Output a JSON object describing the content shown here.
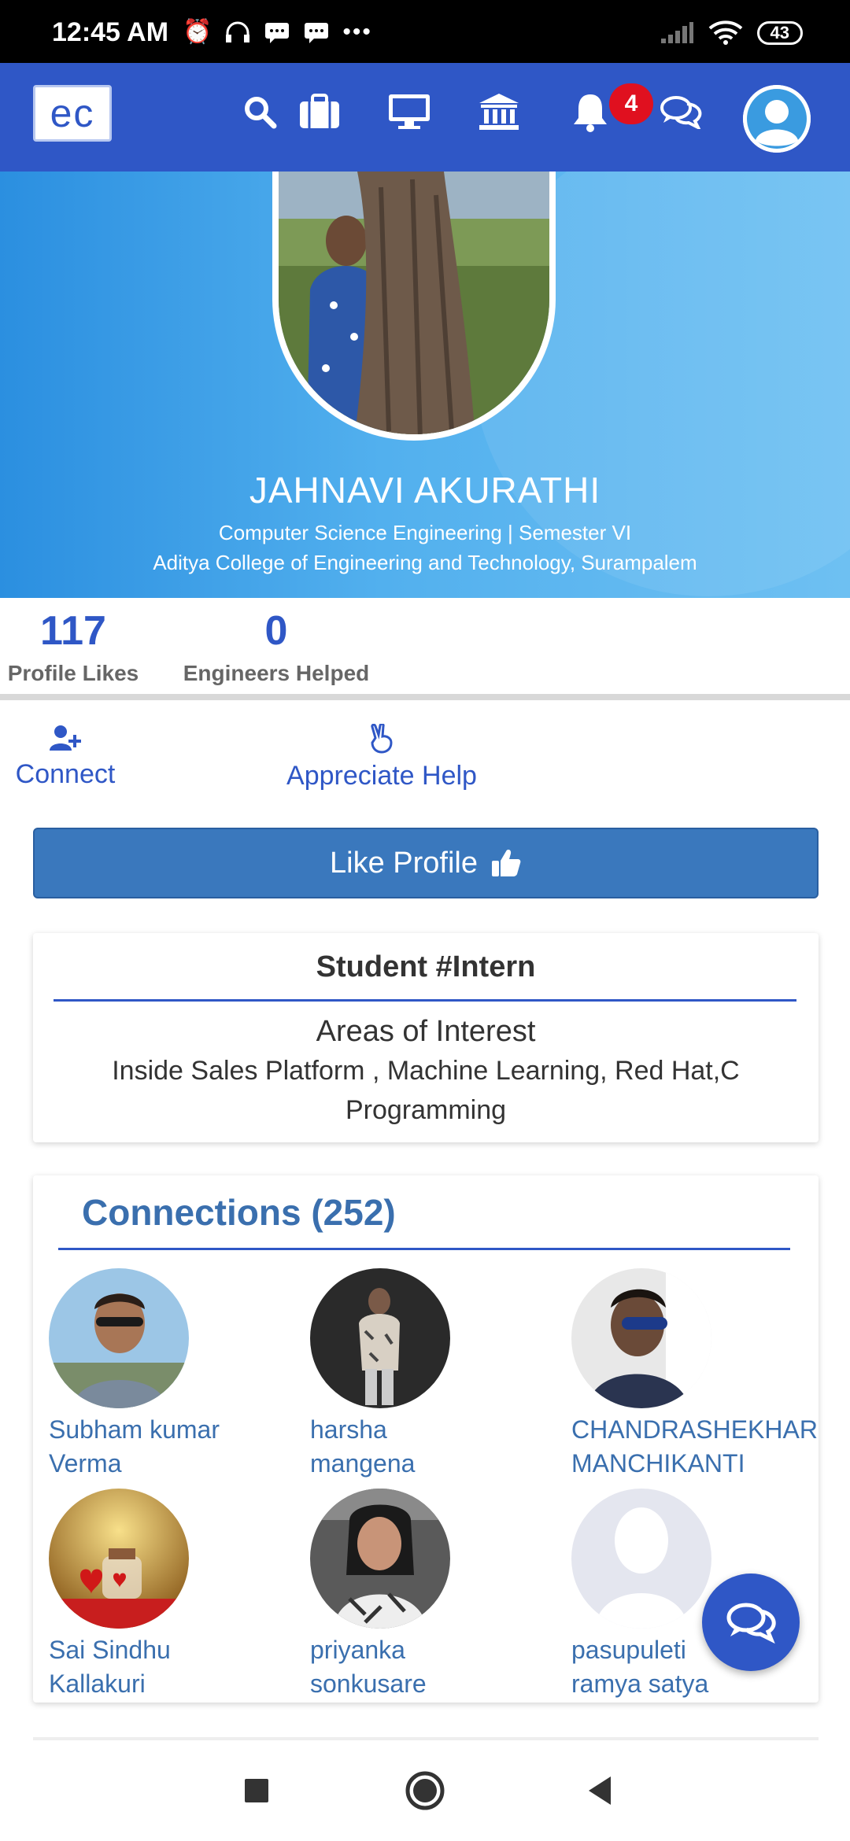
{
  "status_bar": {
    "time": "12:45 AM",
    "icons_left": [
      "alarm-icon",
      "headset-icon",
      "message-icon",
      "message-icon",
      "more-dots-icon"
    ],
    "battery": "43"
  },
  "header": {
    "logo_text": "ec",
    "notification_count": "4",
    "icons": [
      "search-icon",
      "briefcase-icon",
      "monitor-icon",
      "institution-icon",
      "bell-icon",
      "chat-icon",
      "profile-avatar"
    ]
  },
  "profile": {
    "name": "JAHNAVI AKURATHI",
    "department": "Computer Science Engineering | Semester VI",
    "college": "Aditya College of Engineering and Technology, Surampalem"
  },
  "stats": {
    "likes_value": "117",
    "likes_label": "Profile Likes",
    "helped_value": "0",
    "helped_label": "Engineers Helped"
  },
  "actions": {
    "connect_label": "Connect",
    "appreciate_label": "Appreciate Help",
    "like_label": "Like Profile"
  },
  "about": {
    "title": "Student #Intern",
    "interest_heading": "Areas of Interest",
    "interest_line1": "Inside Sales Platform , Machine Learning, Red Hat,C",
    "interest_line2": "Programming"
  },
  "connections": {
    "title": "Connections (252)",
    "items": [
      {
        "first": "Subham kumar",
        "second": "Verma"
      },
      {
        "first": "harsha",
        "second": "mangena"
      },
      {
        "first": "CHANDRASHEKHAR",
        "second": "MANCHIKANTI"
      },
      {
        "first": "Sai Sindhu",
        "second": "Kallakuri"
      },
      {
        "first": "priyanka",
        "second": "sonkusare"
      },
      {
        "first": "pasupuleti",
        "second": "ramya satya"
      }
    ]
  },
  "colors": {
    "brand_blue": "#2f57c6",
    "link_blue": "#3a6fae",
    "badge_red": "#e0101f"
  }
}
